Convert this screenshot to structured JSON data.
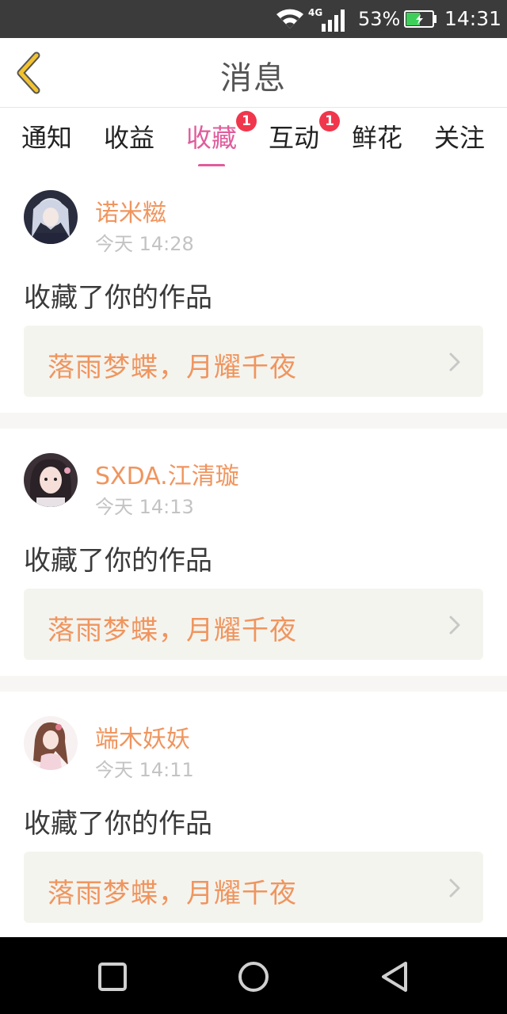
{
  "status_bar": {
    "network": "4G",
    "battery_percent": "53%",
    "time": "14:31",
    "battery_level": 0.53
  },
  "header": {
    "title": "消息",
    "back_icon": "chevron-left-icon"
  },
  "tabs": [
    {
      "label": "通知",
      "active": false,
      "badge": ""
    },
    {
      "label": "收益",
      "active": false,
      "badge": ""
    },
    {
      "label": "收藏",
      "active": true,
      "badge": "1"
    },
    {
      "label": "互动",
      "active": false,
      "badge": "1"
    },
    {
      "label": "鲜花",
      "active": false,
      "badge": ""
    },
    {
      "label": "关注",
      "active": false,
      "badge": ""
    }
  ],
  "messages": [
    {
      "username": "诺米糍",
      "time": "今天 14:28",
      "action": "收藏了你的作品",
      "work_title": "落雨梦蝶，月耀千夜"
    },
    {
      "username": "SXDA.江清璇",
      "time": "今天 14:13",
      "action": "收藏了你的作品",
      "work_title": "落雨梦蝶，月耀千夜"
    },
    {
      "username": "端木妖妖",
      "time": "今天 14:11",
      "action": "收藏了你的作品",
      "work_title": "落雨梦蝶，月耀千夜"
    }
  ],
  "colors": {
    "accent_pink": "#e05c9c",
    "username_orange": "#f0955e",
    "badge_red": "#f0364c",
    "back_arrow_yellow": "#f2c230"
  }
}
